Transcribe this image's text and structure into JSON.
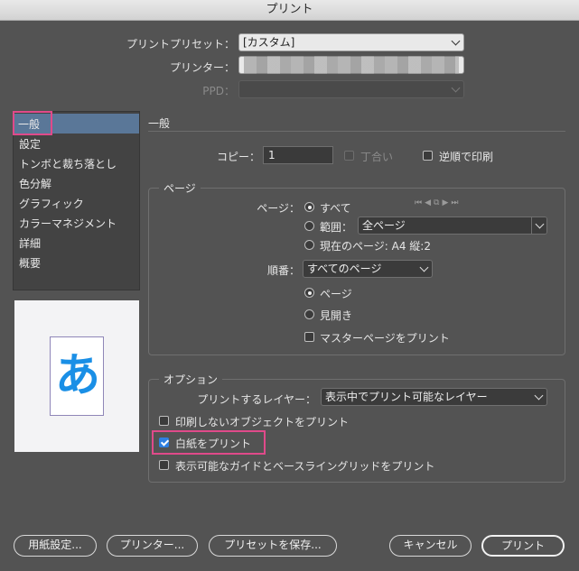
{
  "window": {
    "title": "プリント"
  },
  "preset": {
    "label": "プリントプリセット：",
    "value": "[カスタム]"
  },
  "printer": {
    "label": "プリンター：",
    "value": ""
  },
  "ppd": {
    "label": "PPD：",
    "value": ""
  },
  "sidebar": {
    "items": [
      {
        "label": "一般",
        "selected": true
      },
      {
        "label": "設定"
      },
      {
        "label": "トンボと裁ち落とし"
      },
      {
        "label": "色分解"
      },
      {
        "label": "グラフィック"
      },
      {
        "label": "カラーマネジメント"
      },
      {
        "label": "詳細"
      },
      {
        "label": "概要"
      }
    ]
  },
  "preview": {
    "glyph": "あ"
  },
  "general": {
    "title": "一般",
    "copies_label": "コピー：",
    "copies_value": "1",
    "collate_label": "丁合い",
    "reverse_label": "逆順で印刷"
  },
  "pages": {
    "legend": "ページ",
    "pages_label": "ページ：",
    "all_label": "すべて",
    "range_label": "範囲：",
    "range_value": "全ページ",
    "current_label": "現在のページ: A4 縦:2",
    "order_label": "順番：",
    "order_value": "すべてのページ",
    "page_label": "ページ",
    "spread_label": "見開き",
    "master_label": "マスターページをプリント"
  },
  "options": {
    "legend": "オプション",
    "layer_label": "プリントするレイヤー：",
    "layer_value": "表示中でプリント可能なレイヤー",
    "nonprint_label": "印刷しないオブジェクトをプリント",
    "blank_label": "白紙をプリント",
    "guides_label": "表示可能なガイドとベースライングリッドをプリント"
  },
  "buttons": {
    "page_setup": "用紙設定...",
    "printer": "プリンター...",
    "save_preset": "プリセットを保存...",
    "cancel": "キャンセル",
    "print": "プリント"
  },
  "colors": {
    "highlight": "#e04a8a",
    "selection": "#5a7798",
    "check": "#2f7fe0",
    "glyph": "#1a8fe6"
  }
}
